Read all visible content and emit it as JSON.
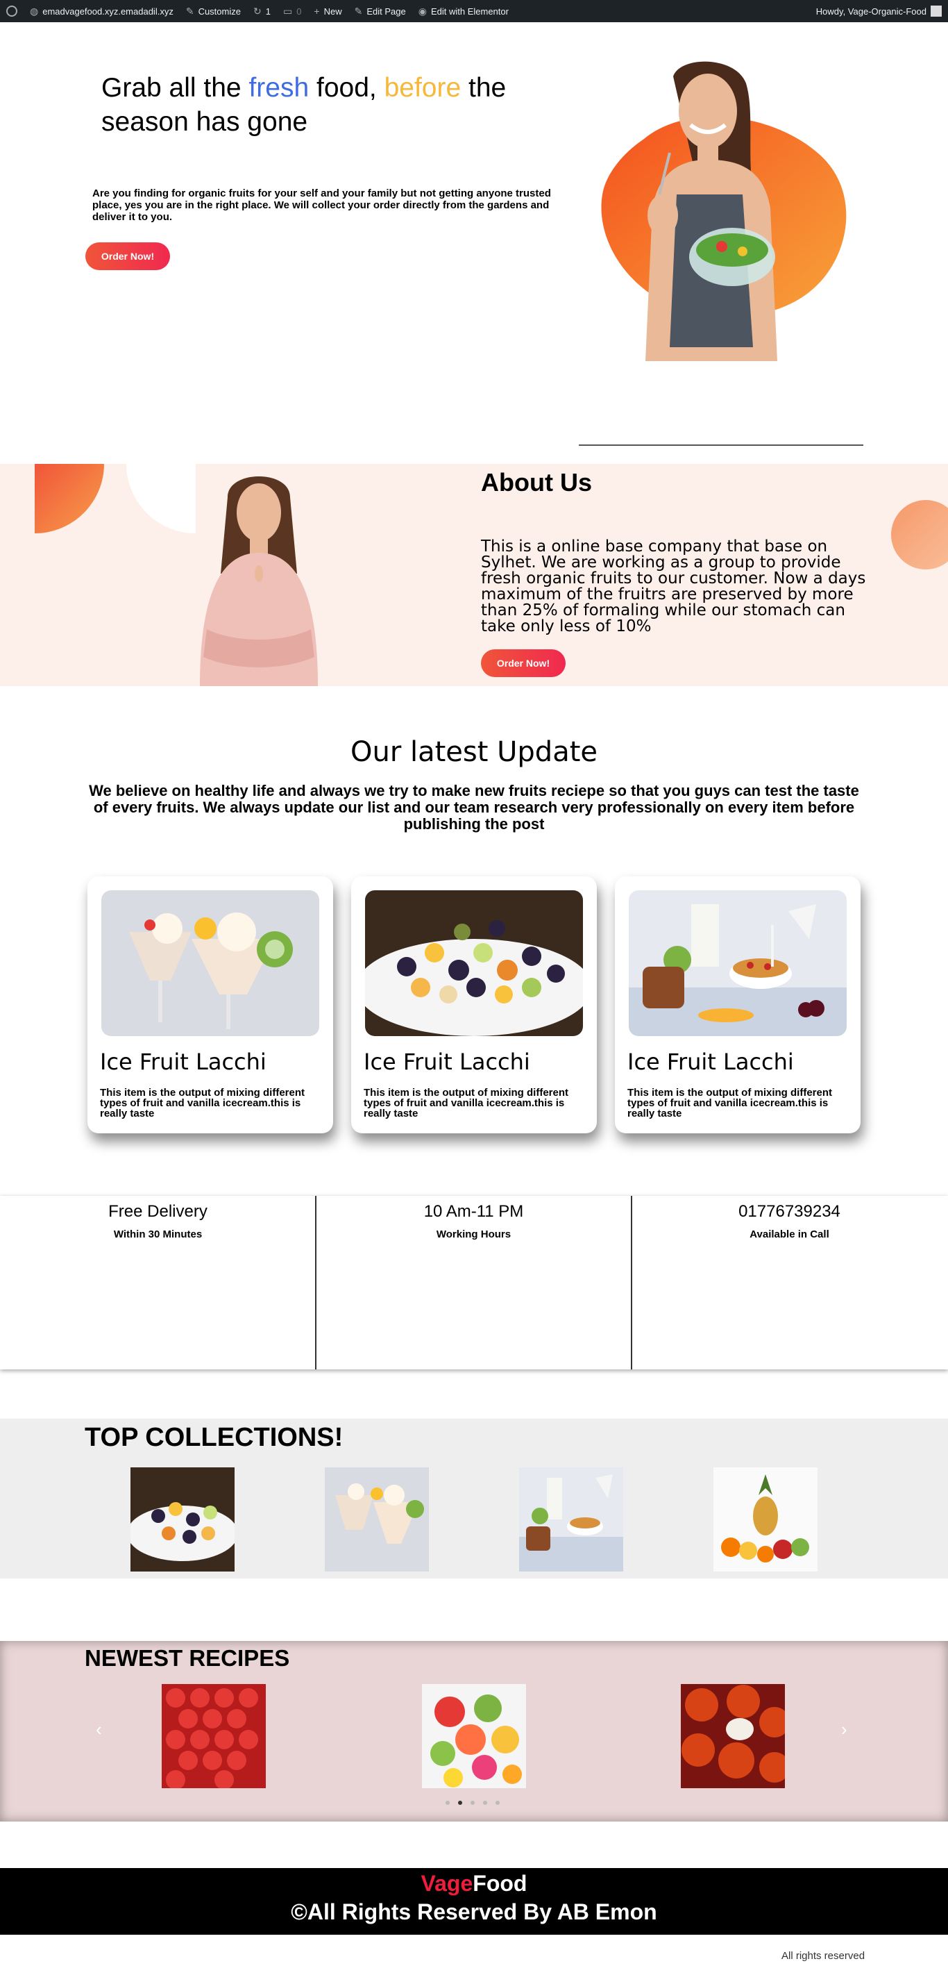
{
  "admin_bar": {
    "site_name": "emadvagefood.xyz.emadadil.xyz",
    "customize": "Customize",
    "updates_count": "1",
    "comments_count": "0",
    "new": "New",
    "edit_page": "Edit Page",
    "edit_elementor": "Edit with Elementor",
    "howdy": "Howdy, Vage-Organic-Food"
  },
  "hero": {
    "title_part1": "Grab all the ",
    "title_fresh": "fresh",
    "title_part2": " food, ",
    "title_before": "before",
    "title_part3": " the season has gone",
    "description": "Are you finding for organic fruits for your self and your family but not getting anyone trusted place, yes you are in the right place. We will collect your order directly from the gardens and deliver it to you.",
    "button": "Order Now!"
  },
  "about": {
    "title": "About Us",
    "text": "This is a online base company that base on Sylhet. We are working as a group to provide fresh organic fruits to our customer. Now a days maximum of the fruitrs are preserved by more than 25% of formaling while our stomach can take only less of 10%",
    "button": "Order Now!"
  },
  "latest": {
    "title": "Our latest Update",
    "text": "We believe on healthy life and always we try to make new fruits reciepe so that you guys can test the taste of every fruits. We always update our list and our team research very professionally on every item before publishing the post",
    "cards": [
      {
        "title": "Ice Fruit Lacchi",
        "text": "This item is the output of mixing different types of fruit and vanilla icecream.this is really taste"
      },
      {
        "title": "Ice Fruit Lacchi",
        "text": "This item is the output of mixing different types of fruit and vanilla icecream.this is really taste"
      },
      {
        "title": "Ice Fruit Lacchi",
        "text": "This item is the output of mixing different types of fruit and vanilla icecream.this is really taste"
      }
    ]
  },
  "info": [
    {
      "heading": "Free Delivery",
      "sub": "Within 30 Minutes"
    },
    {
      "heading": "10 Am-11 PM",
      "sub": "Working Hours"
    },
    {
      "heading": "01776739234",
      "sub": "Available in Call"
    }
  ],
  "top_collections": {
    "title": "TOP COLLECTIONS!"
  },
  "newest_recipes": {
    "title": "NEWEST RECIPES",
    "prev_icon": "‹",
    "next_icon": "›"
  },
  "footer": {
    "brand_red": "Vage",
    "brand_white": "Food",
    "copyright": "©All Rights Reserved By AB Emon",
    "all_rights": "All rights reserved"
  }
}
